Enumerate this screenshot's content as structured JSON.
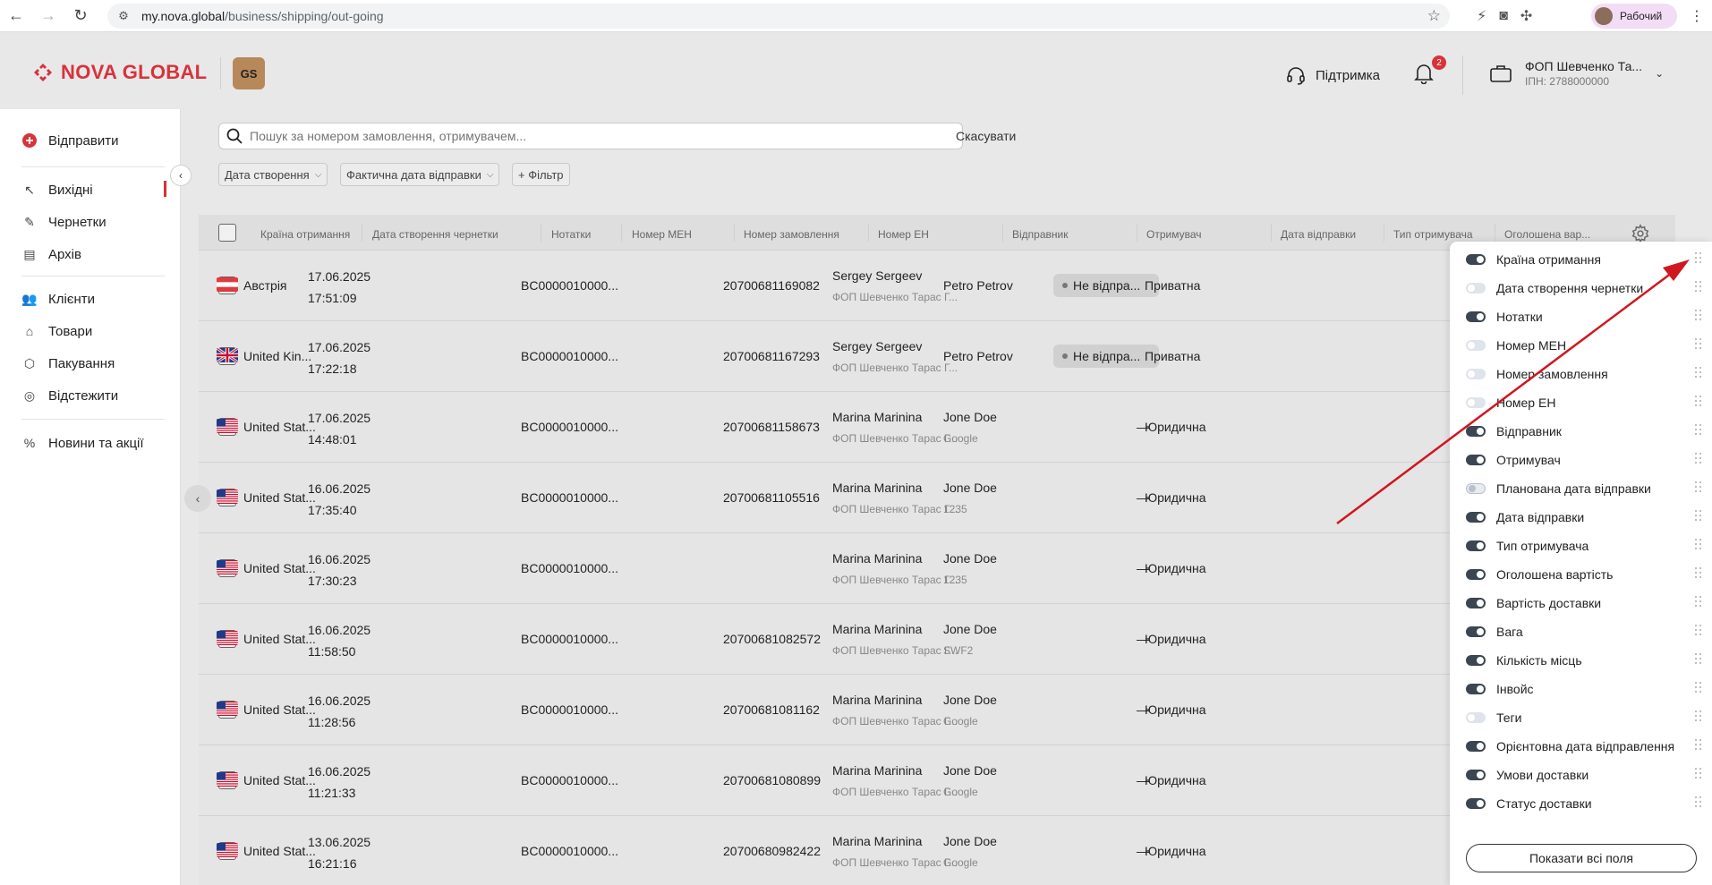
{
  "browser": {
    "url_host": "my.nova.global",
    "url_path": "/business/shipping/out-going",
    "profile_label": "Рабочий"
  },
  "header": {
    "logo_text": "NOVA GLOBAL",
    "badge": "GS",
    "support_label": "Підтримка",
    "notifications_count": "2",
    "account_name": "ФОП Шевченко Та...",
    "account_inn": "ІПН: 2788000000"
  },
  "sidebar": {
    "send_label": "Відправити",
    "items": [
      {
        "label": "Вихідні",
        "icon": "arrow-up-left-icon"
      },
      {
        "label": "Чернетки",
        "icon": "edit-icon"
      },
      {
        "label": "Архів",
        "icon": "archive-icon"
      },
      {
        "label": "Клієнти",
        "icon": "users-icon"
      },
      {
        "label": "Товари",
        "icon": "tag-icon"
      },
      {
        "label": "Пакування",
        "icon": "box-icon"
      },
      {
        "label": "Відстежити",
        "icon": "target-icon"
      },
      {
        "label": "Новини та акції",
        "icon": "percent-icon"
      }
    ]
  },
  "toolbar": {
    "search_placeholder": "Пошук за номером замовлення, отримувачем...",
    "cancel_label": "Скасувати",
    "filters": [
      "Дата створення",
      "Фактична дата відправки"
    ],
    "add_filter_label": "+ Фільтр"
  },
  "table": {
    "columns": [
      "Країна отримання",
      "Дата створення чернетки",
      "Нотатки",
      "Номер МЕН",
      "Номер замовлення",
      "Номер ЕН",
      "Відправник",
      "Отримувач",
      "Дата відправки",
      "Тип отримувача",
      "Оголошена вар..."
    ],
    "rows": [
      {
        "country": "Австрія",
        "flag": "AT",
        "date": "17.06.2025",
        "time": "17:51:09",
        "men": "BC0000010000...",
        "en": "20700681169082",
        "sender": "Sergey Sergeev",
        "sender_sub": "ФОП Шевченко Тарас Г...",
        "recipient": "Petro Petrov",
        "recipient_sub": "",
        "ship_date": "Не відпра...",
        "type": "Приватна"
      },
      {
        "country": "United Kin...",
        "flag": "GB",
        "date": "17.06.2025",
        "time": "17:22:18",
        "men": "BC0000010000...",
        "en": "20700681167293",
        "sender": "Sergey Sergeev",
        "sender_sub": "ФОП Шевченко Тарас Г...",
        "recipient": "Petro Petrov",
        "recipient_sub": "",
        "ship_date": "Не відпра...",
        "type": "Приватна"
      },
      {
        "country": "United Stat...",
        "flag": "US",
        "date": "17.06.2025",
        "time": "14:48:01",
        "men": "BC0000010000...",
        "en": "20700681158673",
        "sender": "Marina Marinina",
        "sender_sub": "ФОП Шевченко Тарас Г...",
        "recipient": "Jone Doe",
        "recipient_sub": "Google",
        "ship_date": "—",
        "type": "Юридична"
      },
      {
        "country": "United Stat...",
        "flag": "US",
        "date": "16.06.2025",
        "time": "17:35:40",
        "men": "BC0000010000...",
        "en": "20700681105516",
        "sender": "Marina Marinina",
        "sender_sub": "ФОП Шевченко Тарас Г...",
        "recipient": "Jone Doe",
        "recipient_sub": "1235",
        "ship_date": "—",
        "type": "Юридична"
      },
      {
        "country": "United Stat...",
        "flag": "US",
        "date": "16.06.2025",
        "time": "17:30:23",
        "men": "BC0000010000...",
        "en": "",
        "sender": "Marina Marinina",
        "sender_sub": "ФОП Шевченко Тарас Г...",
        "recipient": "Jone Doe",
        "recipient_sub": "1235",
        "ship_date": "—",
        "type": "Юридична"
      },
      {
        "country": "United Stat...",
        "flag": "US",
        "date": "16.06.2025",
        "time": "11:58:50",
        "men": "BC0000010000...",
        "en": "20700681082572",
        "sender": "Marina Marinina",
        "sender_sub": "ФОП Шевченко Тарас Г...",
        "recipient": "Jone Doe",
        "recipient_sub": "SWF2",
        "ship_date": "—",
        "type": "Юридична"
      },
      {
        "country": "United Stat...",
        "flag": "US",
        "date": "16.06.2025",
        "time": "11:28:56",
        "men": "BC0000010000...",
        "en": "20700681081162",
        "sender": "Marina Marinina",
        "sender_sub": "ФОП Шевченко Тарас Г...",
        "recipient": "Jone Doe",
        "recipient_sub": "Google",
        "ship_date": "—",
        "type": "Юридична"
      },
      {
        "country": "United Stat...",
        "flag": "US",
        "date": "16.06.2025",
        "time": "11:21:33",
        "men": "BC0000010000...",
        "en": "20700681080899",
        "sender": "Marina Marinina",
        "sender_sub": "ФОП Шевченко Тарас Г...",
        "recipient": "Jone Doe",
        "recipient_sub": "Google",
        "ship_date": "—",
        "type": "Юридична"
      },
      {
        "country": "United Stat...",
        "flag": "US",
        "date": "13.06.2025",
        "time": "16:21:16",
        "men": "BC0000010000...",
        "en": "20700680982422",
        "sender": "Marina Marinina",
        "sender_sub": "ФОП Шевченко Тарас Г...",
        "recipient": "Jone Doe",
        "recipient_sub": "Google",
        "ship_date": "—",
        "type": "Юридична"
      }
    ]
  },
  "column_settings": {
    "items": [
      {
        "label": "Країна отримання",
        "state": "on"
      },
      {
        "label": "Дата створення чернетки",
        "state": "off"
      },
      {
        "label": "Нотатки",
        "state": "on"
      },
      {
        "label": "Номер МЕН",
        "state": "off"
      },
      {
        "label": "Номер замовлення",
        "state": "off"
      },
      {
        "label": "Номер ЕН",
        "state": "off"
      },
      {
        "label": "Відправник",
        "state": "on"
      },
      {
        "label": "Отримувач",
        "state": "on"
      },
      {
        "label": "Планована дата відправки",
        "state": "half"
      },
      {
        "label": "Дата відправки",
        "state": "on"
      },
      {
        "label": "Тип отримувача",
        "state": "on"
      },
      {
        "label": "Оголошена вартість",
        "state": "on"
      },
      {
        "label": "Вартість доставки",
        "state": "on"
      },
      {
        "label": "Вага",
        "state": "on"
      },
      {
        "label": "Кількість місць",
        "state": "on"
      },
      {
        "label": "Інвойс",
        "state": "on"
      },
      {
        "label": "Теги",
        "state": "off"
      },
      {
        "label": "Орієнтовна дата відправлення",
        "state": "on"
      },
      {
        "label": "Умови доставки",
        "state": "on"
      },
      {
        "label": "Статус доставки",
        "state": "on"
      }
    ],
    "show_all_label": "Показати всі поля"
  },
  "colors": {
    "brand_red": "#d8323b",
    "toggle_on": "#3c4652",
    "annotation_arrow": "#d0161f"
  }
}
